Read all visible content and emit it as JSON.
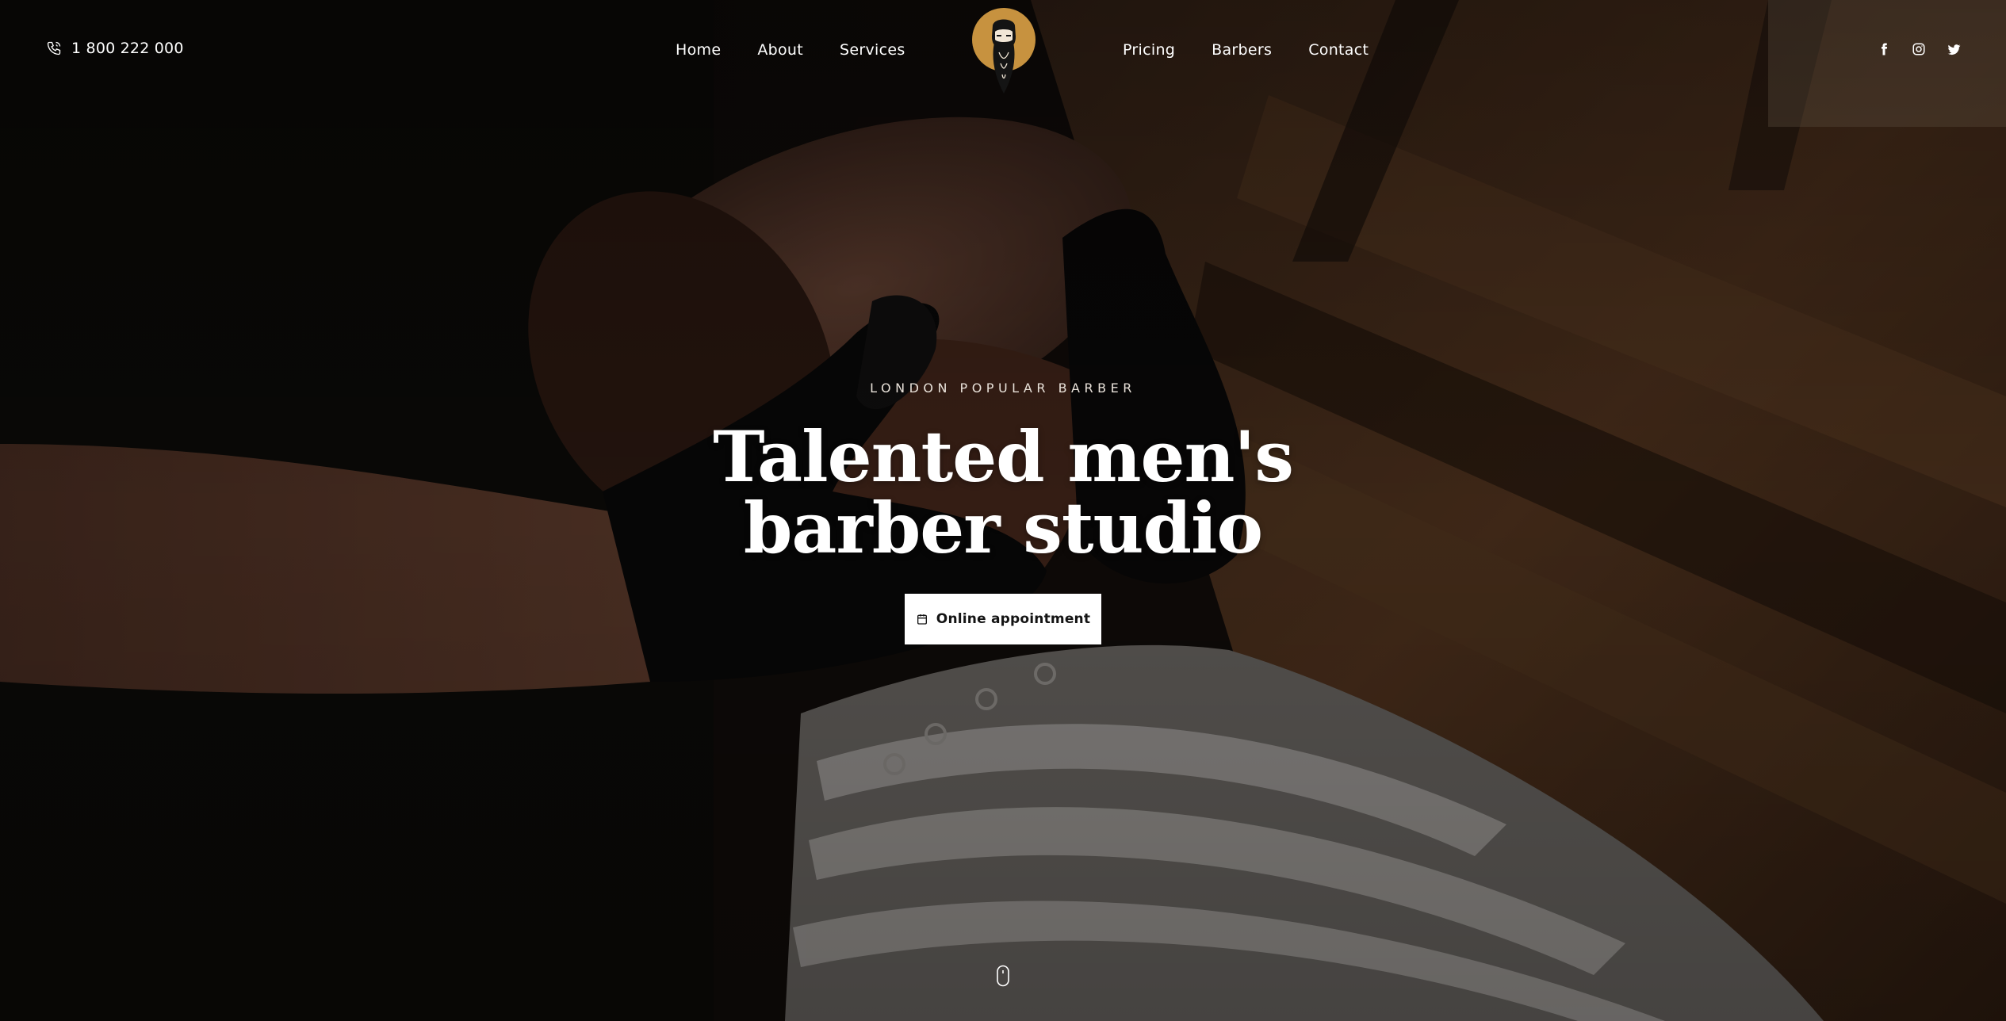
{
  "header": {
    "phone": "1 800 222 000",
    "nav_left": [
      "Home",
      "About",
      "Services"
    ],
    "nav_right": [
      "Pricing",
      "Barbers",
      "Contact"
    ],
    "social_icons": [
      "facebook-icon",
      "instagram-icon",
      "twitter-icon"
    ],
    "logo_icon": "bearded-man-logo-icon"
  },
  "hero": {
    "eyebrow": "LONDON POPULAR BARBER",
    "headline_line1": "Talented men's",
    "headline_line2": "barber studio",
    "cta_label": "Online appointment",
    "cta_icon": "calendar-icon",
    "scroll_icon": "mouse-scroll-icon"
  },
  "colors": {
    "logo_accent": "#c7923f",
    "text": "#ffffff",
    "button_bg": "#ffffff",
    "button_text": "#141414"
  }
}
